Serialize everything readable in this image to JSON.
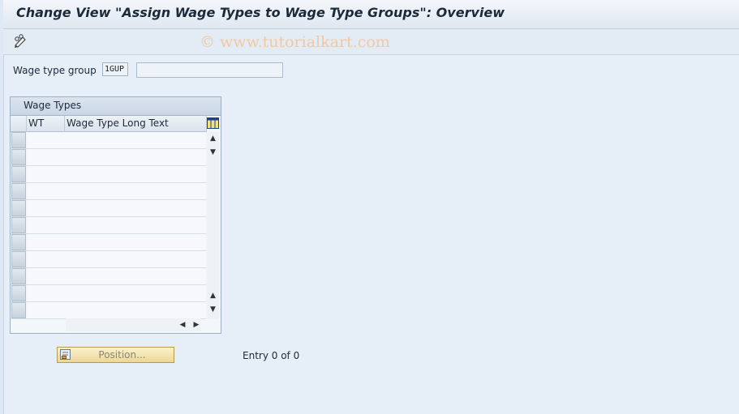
{
  "window": {
    "title": "Change View \"Assign Wage Types to Wage Type Groups\": Overview"
  },
  "toolbar": {
    "change_display_icon": "pencil-glasses-icon"
  },
  "watermark": "© www.tutorialkart.com",
  "form": {
    "wage_type_group_label": "Wage type group",
    "wage_type_group_value": "1GUP",
    "wage_type_group_text": ""
  },
  "table": {
    "caption": "Wage Types",
    "columns": [
      "WT",
      "Wage Type Long Text"
    ],
    "rows": [
      {
        "wt": "",
        "text": ""
      },
      {
        "wt": "",
        "text": ""
      },
      {
        "wt": "",
        "text": ""
      },
      {
        "wt": "",
        "text": ""
      },
      {
        "wt": "",
        "text": ""
      },
      {
        "wt": "",
        "text": ""
      },
      {
        "wt": "",
        "text": ""
      },
      {
        "wt": "",
        "text": ""
      },
      {
        "wt": "",
        "text": ""
      },
      {
        "wt": "",
        "text": ""
      },
      {
        "wt": "",
        "text": ""
      }
    ]
  },
  "footer": {
    "position_button_label": "Position...",
    "entry_text": "Entry 0 of 0"
  },
  "colors": {
    "accent_button": "#ecd796",
    "title_text": "#1b2a3a"
  }
}
